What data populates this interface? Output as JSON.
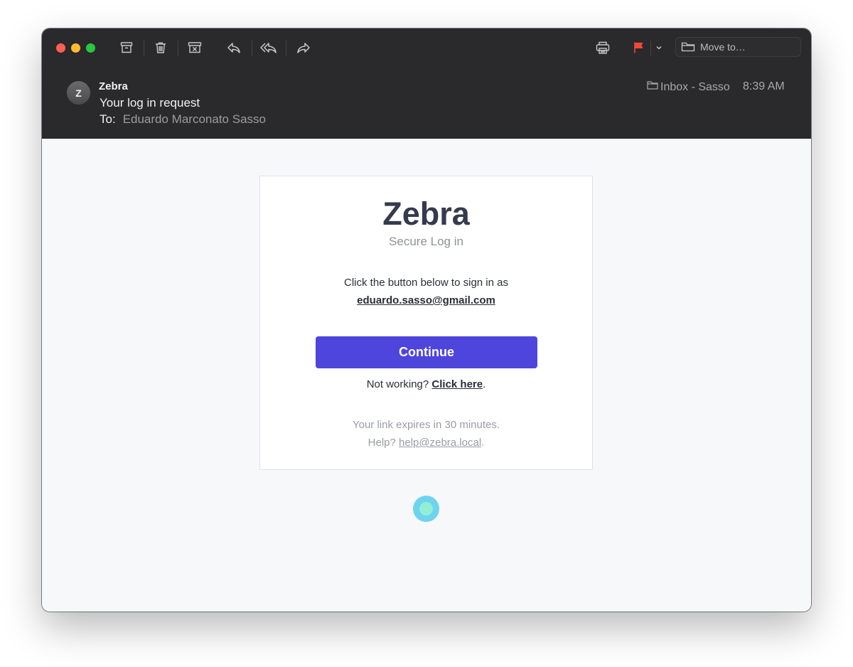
{
  "toolbar": {
    "buttons": [
      {
        "icon": "archive-icon"
      },
      {
        "icon": "trash-icon"
      },
      {
        "icon": "junk-icon"
      },
      {
        "icon": "reply-icon"
      },
      {
        "icon": "reply-all-icon"
      },
      {
        "icon": "forward-icon"
      },
      {
        "icon": "print-icon"
      },
      {
        "icon": "flag-icon",
        "color": "#f2483b"
      },
      {
        "icon": "chevron-down-icon"
      }
    ],
    "move_to_label": "Move to…"
  },
  "message": {
    "avatar_initial": "Z",
    "sender": "Zebra",
    "subject": "Your log in request",
    "to_label": "To:",
    "to_name": "Eduardo Marconato Sasso",
    "mailbox": "Inbox - Sasso",
    "time": "8:39 AM"
  },
  "email_body": {
    "brand": "Zebra",
    "tagline": "Secure Log in",
    "instruction": "Click the button below to sign in as",
    "email": "eduardo.sasso@gmail.com",
    "continue_label": "Continue",
    "not_working_prefix": "Not working?",
    "click_here_label": "Click here",
    "not_working_suffix": ".",
    "expires_text": "Your link expires in 30 minutes.",
    "help_prefix": "Help?",
    "help_email": "help@zebra.local",
    "help_suffix": "."
  },
  "colors": {
    "accent": "#4e45dc",
    "titlebar": "#2a292b",
    "brand_text": "#353a4d",
    "flag": "#f2483b"
  }
}
